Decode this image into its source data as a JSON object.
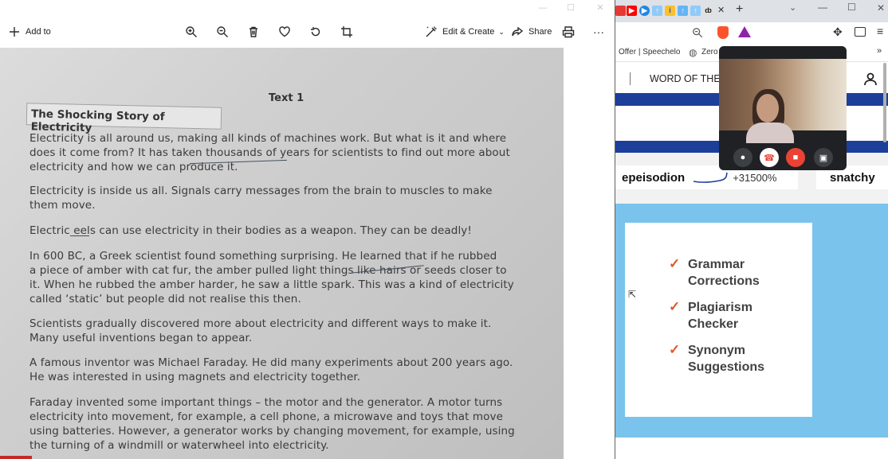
{
  "photos_app": {
    "toolbar": {
      "add_to_label": "Add to",
      "edit_create_label": "Edit & Create",
      "share_label": "Share",
      "more_label": "···"
    },
    "document": {
      "text_number": "Text 1",
      "title": "The Shocking Story of Electricity",
      "lines": [
        "Electricity is all around us, making all kinds of machines work. But what is it and where",
        "does it come from? It has taken thousands of years for scientists to find out more about",
        "electricity and how we can produce it.",
        "Electricity is inside us all. Signals carry messages from the brain to muscles to make",
        "them move.",
        "Electric eels can use electricity in their bodies as a weapon. They can be deadly!",
        "In 600 BC, a Greek scientist found something surprising. He learned that if he rubbed",
        "a piece of amber with cat fur, the amber pulled light things like hairs or seeds closer to",
        "it. When he rubbed the amber harder, he saw a little spark. This was a kind of electricity",
        "called ‘static’ but people did not realise this then.",
        "Scientists gradually discovered more about electricity and different ways to make it.",
        "Many useful inventions began to appear.",
        "A famous inventor was Michael Faraday. He did many experiments about 200 years ago.",
        "He was interested in using magnets and electricity together.",
        "Faraday invented some important things – the motor and the generator. A motor turns",
        "electricity into movement, for example, a cell phone, a microwave and toys that move",
        "using batteries. However, a generator works by changing movement, for example, using",
        "the turning of a windmill or waterwheel into electricity."
      ]
    }
  },
  "browser": {
    "bookmarks": {
      "item1": "Offer | Speechelo",
      "item2": "Zero"
    },
    "page": {
      "header_text": "WORD OF THE",
      "trend_word": "epeisodion",
      "trend_value": "+31500%",
      "trend_word2": "snatchy",
      "ad_items": [
        "Grammar Corrections",
        "Plagiarism Checker",
        "Synonym Suggestions"
      ]
    }
  },
  "colors": {
    "site_blue": "#1d3f9a",
    "ad_background": "#79c3ec",
    "check_color": "#e05a2b",
    "end_call_color": "#ffffff",
    "video_off_color": "#ea4335"
  }
}
